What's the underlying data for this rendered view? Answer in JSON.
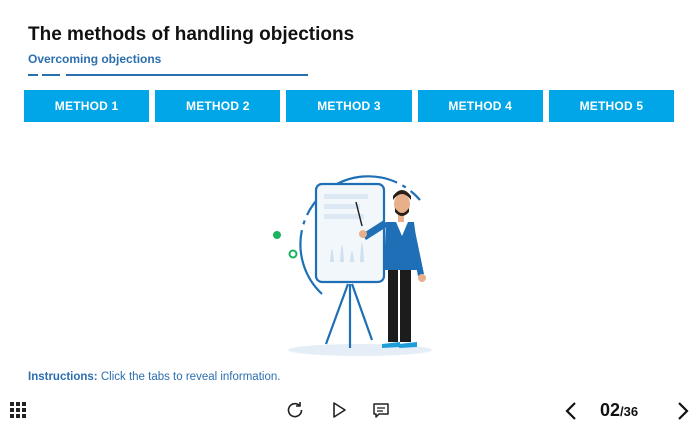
{
  "header": {
    "title": "The methods of handling objections",
    "subtitle": "Overcoming objections"
  },
  "tabs": [
    {
      "label": "METHOD 1"
    },
    {
      "label": "METHOD 2"
    },
    {
      "label": "METHOD 3"
    },
    {
      "label": "METHOD 4"
    },
    {
      "label": "METHOD 5"
    }
  ],
  "instructions": {
    "label": "Instructions:",
    "text": " Click the tabs to reveal information."
  },
  "navigation": {
    "current": "02",
    "total": "/36"
  },
  "icons": {
    "menu": "grid-icon",
    "replay": "replay-icon",
    "play": "play-icon",
    "transcript": "caption-icon",
    "prev": "chevron-left-icon",
    "next": "chevron-right-icon"
  },
  "colors": {
    "accent": "#00a6e8",
    "brand": "#2c6fb0",
    "green": "#1bb35f"
  }
}
